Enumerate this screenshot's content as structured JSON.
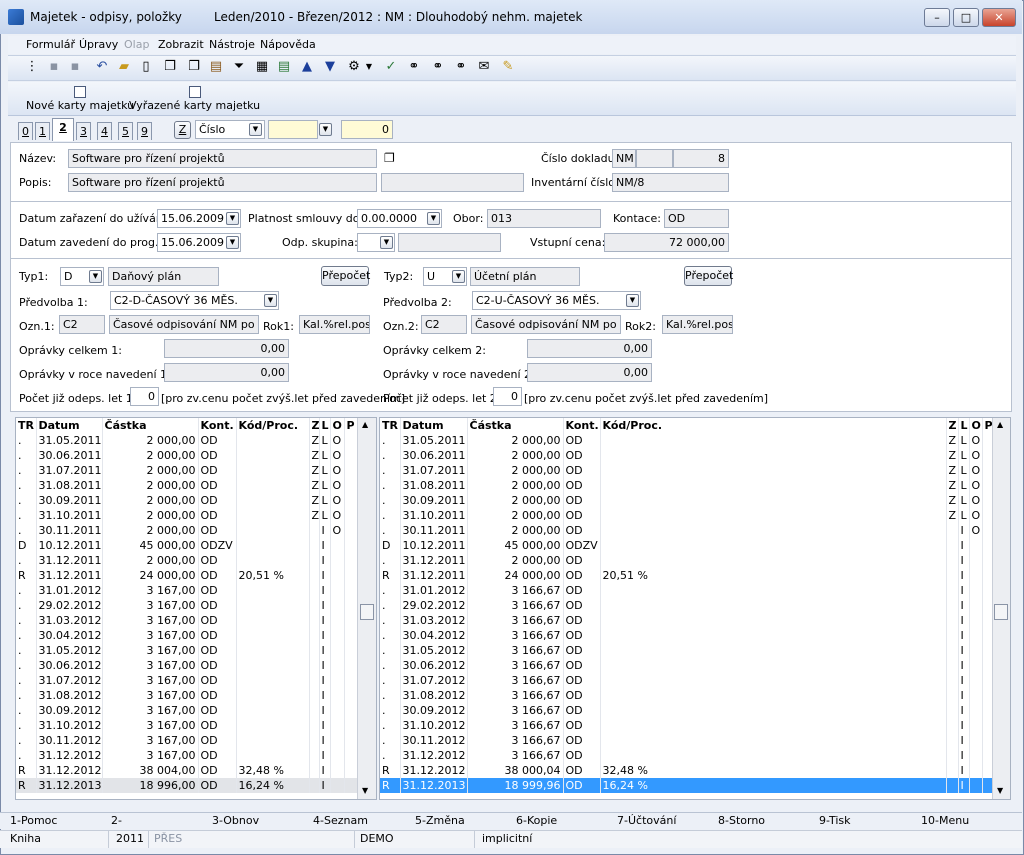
{
  "window": {
    "title": "Majetek - odpisy, položky",
    "subtitle": "Leden/2010 - Březen/2012 : NM : Dlouhodobý nehm. majetek"
  },
  "menu": [
    "Formulář",
    "Úpravy",
    "Olap",
    "Zobrazit",
    "Nástroje",
    "Nápověda"
  ],
  "bigtoolbar": [
    "Nové karty majetku",
    "Vyřazené karty majetku"
  ],
  "tabs": [
    "0",
    "1",
    "2",
    "3",
    "4",
    "5",
    "9"
  ],
  "filter": {
    "z_label": "Z",
    "sort_field": "Číslo",
    "search_value": "",
    "counter": "0"
  },
  "header": {
    "nazev_label": "Název:",
    "nazev": "Software pro řízení projektů",
    "popis_label": "Popis:",
    "popis": "Software pro řízení projektů",
    "cislo_dokladu_label": "Číslo dokladu:",
    "doklad_prefix": "NM",
    "doklad_num": "8",
    "inventarni_label": "Inventární číslo:",
    "inventarni": "NM/8"
  },
  "dates": {
    "zarazeni_label": "Datum zařazení do užívání:",
    "zarazeni": "15.06.2009",
    "zavedeni_label": "Datum zavedení do prog.:",
    "zavedeni": "15.06.2009",
    "platnost_label": "Platnost smlouvy do:",
    "platnost": "0.00.0000",
    "odp_skupina_label": "Odp. skupina:",
    "obor_label": "Obor:",
    "obor": "013",
    "kontace_label": "Kontace:",
    "kontace": "OD",
    "vstupni_label": "Vstupní cena:",
    "vstupni": "72 000,00"
  },
  "left": {
    "typ_label": "Typ1:",
    "typ": "D",
    "typ_name": "Daňový plán",
    "prepocet": "Přepočet",
    "predvolba_label": "Předvolba 1:",
    "predvolba": "C2-D-ČASOVÝ 36 MĚS.",
    "ozn_label": "Ozn.1:",
    "ozn": "C2",
    "ozn_desc": "Časové odpisování NM po 36 m",
    "rok_label": "Rok1:",
    "rok": "Kal.%rel.pos",
    "opr_celkem_label": "Oprávky celkem 1:",
    "opr_celkem": "0,00",
    "opr_roce_label": "Oprávky v roce navedení 1:",
    "opr_roce": "0,00",
    "pocet_label": "Počet již odeps. let 1:",
    "pocet": "0",
    "pocet_note": "[pro zv.cenu počet zvýš.let před zavedením]"
  },
  "right": {
    "typ_label": "Typ2:",
    "typ": "U",
    "typ_name": "Účetní plán",
    "prepocet": "Přepočet",
    "predvolba_label": "Předvolba 2:",
    "predvolba": "C2-U-ČASOVÝ 36 MĚS.",
    "ozn_label": "Ozn.2:",
    "ozn": "C2",
    "ozn_desc": "Časové odpisování NM po 36 m",
    "rok_label": "Rok2:",
    "rok": "Kal.%rel.pos",
    "opr_celkem_label": "Oprávky celkem 2:",
    "opr_celkem": "0,00",
    "opr_roce_label": "Oprávky v roce navedení 2:",
    "opr_roce": "0,00",
    "pocet_label": "Počet již odeps. let 2:",
    "pocet": "0",
    "pocet_note": "[pro zv.cenu počet zvýš.let před zavedením]"
  },
  "grid_columns": [
    "TR",
    "Datum",
    "Částka",
    "Kont.",
    "Kód/Proc.",
    "Z",
    "L",
    "O",
    "P"
  ],
  "grid_left": [
    [
      ".",
      "31.05.2011",
      "2 000,00",
      "OD",
      "",
      "Z",
      "L",
      "O",
      ""
    ],
    [
      ".",
      "30.06.2011",
      "2 000,00",
      "OD",
      "",
      "Z",
      "L",
      "O",
      ""
    ],
    [
      ".",
      "31.07.2011",
      "2 000,00",
      "OD",
      "",
      "Z",
      "L",
      "O",
      ""
    ],
    [
      ".",
      "31.08.2011",
      "2 000,00",
      "OD",
      "",
      "Z",
      "L",
      "O",
      ""
    ],
    [
      ".",
      "30.09.2011",
      "2 000,00",
      "OD",
      "",
      "Z",
      "L",
      "O",
      ""
    ],
    [
      ".",
      "31.10.2011",
      "2 000,00",
      "OD",
      "",
      "Z",
      "L",
      "O",
      ""
    ],
    [
      ".",
      "30.11.2011",
      "2 000,00",
      "OD",
      "",
      "",
      "I",
      "O",
      ""
    ],
    [
      "D",
      "10.12.2011",
      "45 000,00",
      "ODZV",
      "",
      "",
      "I",
      "",
      ""
    ],
    [
      ".",
      "31.12.2011",
      "2 000,00",
      "OD",
      "",
      "",
      "I",
      "",
      ""
    ],
    [
      "R",
      "31.12.2011",
      "24 000,00",
      "OD",
      "20,51 %",
      "",
      "I",
      "",
      ""
    ],
    [
      ".",
      "31.01.2012",
      "3 167,00",
      "OD",
      "",
      "",
      "I",
      "",
      ""
    ],
    [
      ".",
      "29.02.2012",
      "3 167,00",
      "OD",
      "",
      "",
      "I",
      "",
      ""
    ],
    [
      ".",
      "31.03.2012",
      "3 167,00",
      "OD",
      "",
      "",
      "I",
      "",
      ""
    ],
    [
      ".",
      "30.04.2012",
      "3 167,00",
      "OD",
      "",
      "",
      "I",
      "",
      ""
    ],
    [
      ".",
      "31.05.2012",
      "3 167,00",
      "OD",
      "",
      "",
      "I",
      "",
      ""
    ],
    [
      ".",
      "30.06.2012",
      "3 167,00",
      "OD",
      "",
      "",
      "I",
      "",
      ""
    ],
    [
      ".",
      "31.07.2012",
      "3 167,00",
      "OD",
      "",
      "",
      "I",
      "",
      ""
    ],
    [
      ".",
      "31.08.2012",
      "3 167,00",
      "OD",
      "",
      "",
      "I",
      "",
      ""
    ],
    [
      ".",
      "30.09.2012",
      "3 167,00",
      "OD",
      "",
      "",
      "I",
      "",
      ""
    ],
    [
      ".",
      "31.10.2012",
      "3 167,00",
      "OD",
      "",
      "",
      "I",
      "",
      ""
    ],
    [
      ".",
      "30.11.2012",
      "3 167,00",
      "OD",
      "",
      "",
      "I",
      "",
      ""
    ],
    [
      ".",
      "31.12.2012",
      "3 167,00",
      "OD",
      "",
      "",
      "I",
      "",
      ""
    ],
    [
      "R",
      "31.12.2012",
      "38 004,00",
      "OD",
      "32,48 %",
      "",
      "I",
      "",
      ""
    ],
    [
      "R",
      "31.12.2013",
      "18 996,00",
      "OD",
      "16,24 %",
      "",
      "I",
      "",
      ""
    ]
  ],
  "grid_right": [
    [
      ".",
      "31.05.2011",
      "2 000,00",
      "OD",
      "",
      "Z",
      "L",
      "O",
      ""
    ],
    [
      ".",
      "30.06.2011",
      "2 000,00",
      "OD",
      "",
      "Z",
      "L",
      "O",
      ""
    ],
    [
      ".",
      "31.07.2011",
      "2 000,00",
      "OD",
      "",
      "Z",
      "L",
      "O",
      ""
    ],
    [
      ".",
      "31.08.2011",
      "2 000,00",
      "OD",
      "",
      "Z",
      "L",
      "O",
      ""
    ],
    [
      ".",
      "30.09.2011",
      "2 000,00",
      "OD",
      "",
      "Z",
      "L",
      "O",
      ""
    ],
    [
      ".",
      "31.10.2011",
      "2 000,00",
      "OD",
      "",
      "Z",
      "L",
      "O",
      ""
    ],
    [
      ".",
      "30.11.2011",
      "2 000,00",
      "OD",
      "",
      "",
      "I",
      "O",
      ""
    ],
    [
      "D",
      "10.12.2011",
      "45 000,00",
      "ODZV",
      "",
      "",
      "I",
      "",
      ""
    ],
    [
      ".",
      "31.12.2011",
      "2 000,00",
      "OD",
      "",
      "",
      "I",
      "",
      ""
    ],
    [
      "R",
      "31.12.2011",
      "24 000,00",
      "OD",
      "20,51 %",
      "",
      "I",
      "",
      ""
    ],
    [
      ".",
      "31.01.2012",
      "3 166,67",
      "OD",
      "",
      "",
      "I",
      "",
      ""
    ],
    [
      ".",
      "29.02.2012",
      "3 166,67",
      "OD",
      "",
      "",
      "I",
      "",
      ""
    ],
    [
      ".",
      "31.03.2012",
      "3 166,67",
      "OD",
      "",
      "",
      "I",
      "",
      ""
    ],
    [
      ".",
      "30.04.2012",
      "3 166,67",
      "OD",
      "",
      "",
      "I",
      "",
      ""
    ],
    [
      ".",
      "31.05.2012",
      "3 166,67",
      "OD",
      "",
      "",
      "I",
      "",
      ""
    ],
    [
      ".",
      "30.06.2012",
      "3 166,67",
      "OD",
      "",
      "",
      "I",
      "",
      ""
    ],
    [
      ".",
      "31.07.2012",
      "3 166,67",
      "OD",
      "",
      "",
      "I",
      "",
      ""
    ],
    [
      ".",
      "31.08.2012",
      "3 166,67",
      "OD",
      "",
      "",
      "I",
      "",
      ""
    ],
    [
      ".",
      "30.09.2012",
      "3 166,67",
      "OD",
      "",
      "",
      "I",
      "",
      ""
    ],
    [
      ".",
      "31.10.2012",
      "3 166,67",
      "OD",
      "",
      "",
      "I",
      "",
      ""
    ],
    [
      ".",
      "30.11.2012",
      "3 166,67",
      "OD",
      "",
      "",
      "I",
      "",
      ""
    ],
    [
      ".",
      "31.12.2012",
      "3 166,67",
      "OD",
      "",
      "",
      "I",
      "",
      ""
    ],
    [
      "R",
      "31.12.2012",
      "38 000,04",
      "OD",
      "32,48 %",
      "",
      "I",
      "",
      ""
    ],
    [
      "R",
      "31.12.2013",
      "18 999,96",
      "OD",
      "16,24 %",
      "",
      "I",
      "",
      ""
    ]
  ],
  "fkeys": [
    "1-Pomoc",
    "2-",
    "3-Obnov",
    "4-Seznam",
    "5-Změna",
    "6-Kopie",
    "7-Účtování",
    "8-Storno",
    "9-Tisk",
    "10-Menu"
  ],
  "status": {
    "module": "Kniha",
    "year": "2011",
    "mode": "PŘES",
    "db": "DEMO",
    "profile": "implicitní"
  }
}
